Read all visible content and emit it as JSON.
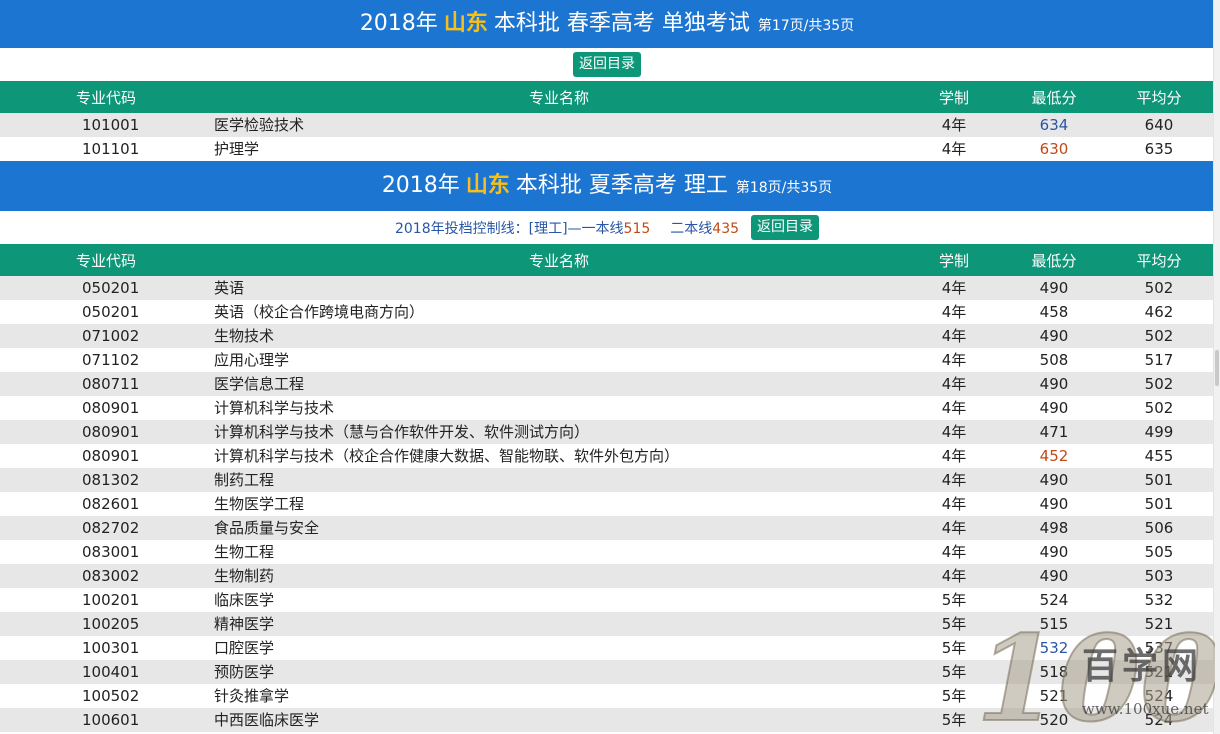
{
  "section1": {
    "title_prefix": "2018年",
    "province": "山东",
    "title_suffix": "本科批 春季高考 单独考试",
    "page_info": "第17页/共35页",
    "back_label": "返回目录",
    "headers": [
      "专业代码",
      "专业名称",
      "学制",
      "最低分",
      "平均分"
    ],
    "rows": [
      {
        "code": "101001",
        "name": "医学检验技术",
        "length": "4年",
        "min": "634",
        "avg": "640",
        "min_color": "blue"
      },
      {
        "code": "101101",
        "name": "护理学",
        "length": "4年",
        "min": "630",
        "avg": "635",
        "min_color": "orange"
      }
    ]
  },
  "section2": {
    "title_prefix": "2018年",
    "province": "山东",
    "title_suffix": "本科批 夏季高考 理工",
    "page_info": "第18页/共35页",
    "control_line": {
      "label": "2018年投档控制线：[理工]—一本线",
      "first_value": "515",
      "second_label": "二本线",
      "second_value": "435"
    },
    "back_label": "返回目录",
    "headers": [
      "专业代码",
      "专业名称",
      "学制",
      "最低分",
      "平均分"
    ],
    "rows": [
      {
        "code": "050201",
        "name": "英语",
        "length": "4年",
        "min": "490",
        "avg": "502"
      },
      {
        "code": "050201",
        "name": "英语（校企合作跨境电商方向）",
        "length": "4年",
        "min": "458",
        "avg": "462"
      },
      {
        "code": "071002",
        "name": "生物技术",
        "length": "4年",
        "min": "490",
        "avg": "502"
      },
      {
        "code": "071102",
        "name": "应用心理学",
        "length": "4年",
        "min": "508",
        "avg": "517"
      },
      {
        "code": "080711",
        "name": "医学信息工程",
        "length": "4年",
        "min": "490",
        "avg": "502"
      },
      {
        "code": "080901",
        "name": "计算机科学与技术",
        "length": "4年",
        "min": "490",
        "avg": "502"
      },
      {
        "code": "080901",
        "name": "计算机科学与技术（慧与合作软件开发、软件测试方向）",
        "length": "4年",
        "min": "471",
        "avg": "499"
      },
      {
        "code": "080901",
        "name": "计算机科学与技术（校企合作健康大数据、智能物联、软件外包方向）",
        "length": "4年",
        "min": "452",
        "avg": "455",
        "min_color": "orange"
      },
      {
        "code": "081302",
        "name": "制药工程",
        "length": "4年",
        "min": "490",
        "avg": "501"
      },
      {
        "code": "082601",
        "name": "生物医学工程",
        "length": "4年",
        "min": "490",
        "avg": "501"
      },
      {
        "code": "082702",
        "name": "食品质量与安全",
        "length": "4年",
        "min": "498",
        "avg": "506"
      },
      {
        "code": "083001",
        "name": "生物工程",
        "length": "4年",
        "min": "490",
        "avg": "505"
      },
      {
        "code": "083002",
        "name": "生物制药",
        "length": "4年",
        "min": "490",
        "avg": "503"
      },
      {
        "code": "100201",
        "name": "临床医学",
        "length": "5年",
        "min": "524",
        "avg": "532"
      },
      {
        "code": "100205",
        "name": "精神医学",
        "length": "5年",
        "min": "515",
        "avg": "521"
      },
      {
        "code": "100301",
        "name": "口腔医学",
        "length": "5年",
        "min": "532",
        "avg": "537",
        "min_color": "blue"
      },
      {
        "code": "100401",
        "name": "预防医学",
        "length": "5年",
        "min": "518",
        "avg": "521"
      },
      {
        "code": "100502",
        "name": "针灸推拿学",
        "length": "5年",
        "min": "521",
        "avg": "524"
      },
      {
        "code": "100601",
        "name": "中西医临床医学",
        "length": "5年",
        "min": "520",
        "avg": "524"
      }
    ]
  },
  "watermark": {
    "number": "100",
    "brand": "百学网",
    "url": "www.100xue.net"
  }
}
